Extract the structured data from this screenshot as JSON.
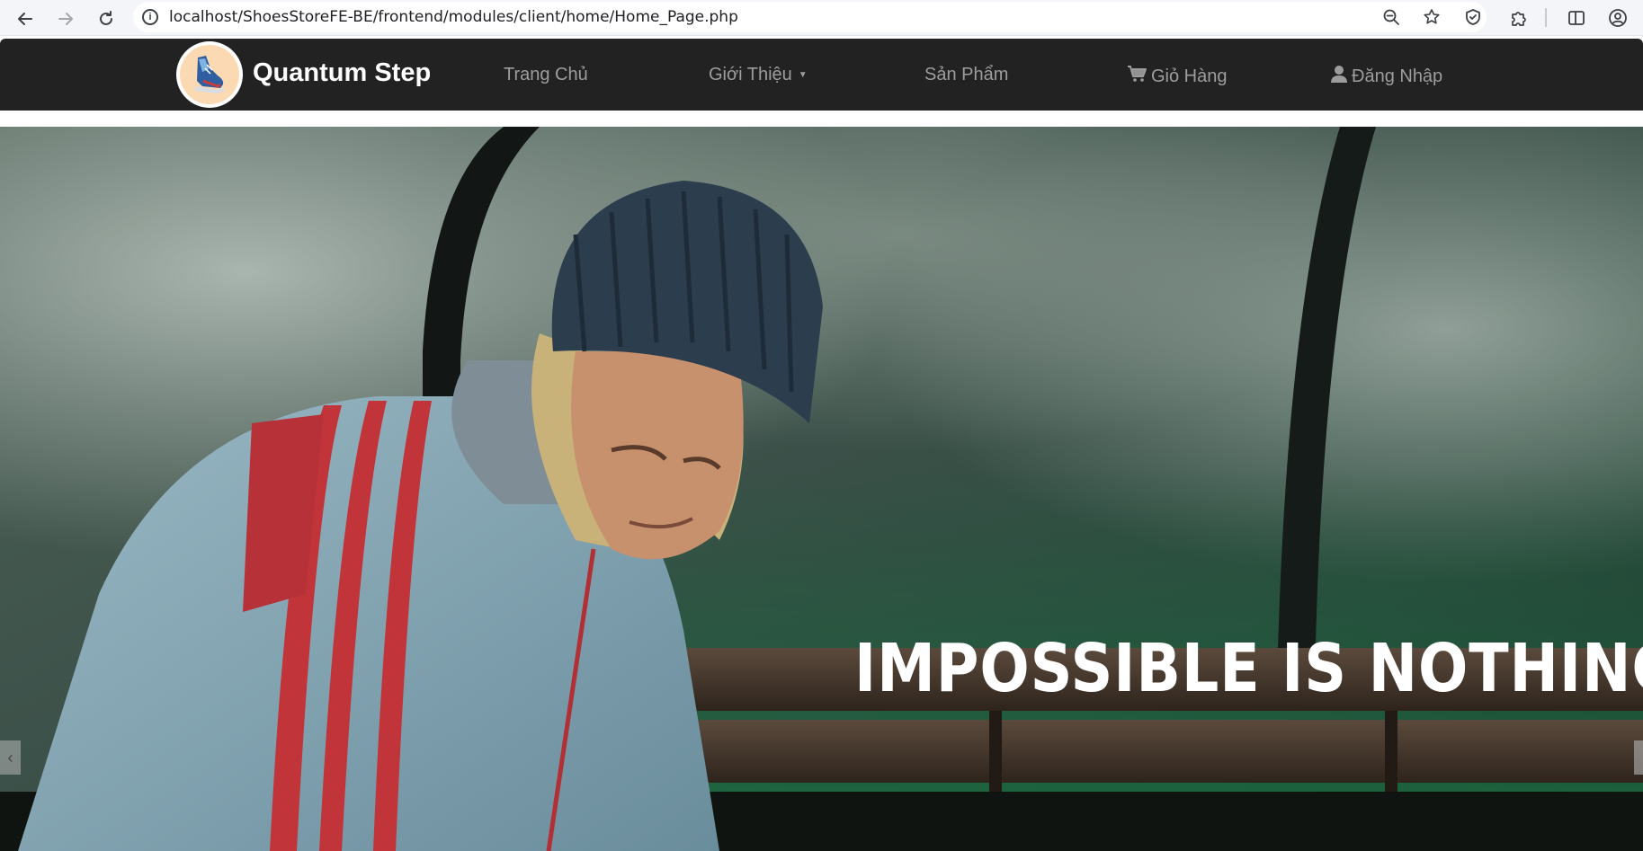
{
  "browser": {
    "url": "localhost/ShoesStoreFE-BE/frontend/modules/client/home/Home_Page.php",
    "icons": {
      "back": "back-arrow-icon",
      "forward": "forward-arrow-icon",
      "reload": "reload-icon",
      "site_info": "info-icon",
      "zoom": "zoom-out-icon",
      "bookmark": "star-icon",
      "shield": "shield-icon",
      "extensions": "puzzle-icon",
      "split": "split-view-icon",
      "profile": "profile-icon"
    }
  },
  "site": {
    "brand": "Quantum Step",
    "nav": {
      "home": "Trang Chủ",
      "about": "Giới Thiệu",
      "products": "Sản Phẩm",
      "cart": "Giỏ Hàng",
      "login": "Đăng Nhập"
    },
    "colors": {
      "navbar_bg": "#222222",
      "nav_link": "#9d9d9d",
      "brand_text": "#ffffff"
    }
  },
  "hero": {
    "tagline": "IMPOSSIBLE IS NOTHING.",
    "prev_label": "‹"
  }
}
